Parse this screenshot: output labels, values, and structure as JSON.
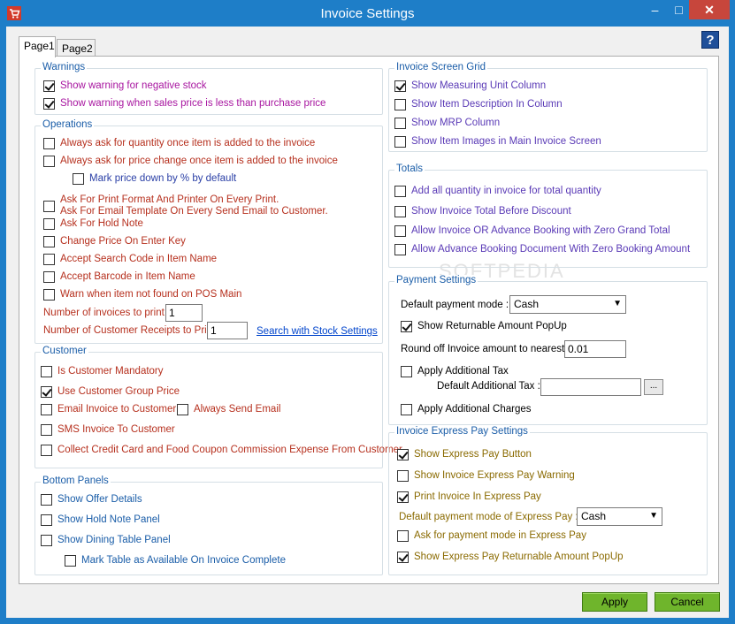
{
  "window": {
    "title": "Invoice Settings",
    "minimize": "–",
    "maximize": "□",
    "close": "✕"
  },
  "tabs": [
    {
      "label": "Page1"
    },
    {
      "label": "Page2"
    }
  ],
  "help": "?",
  "watermark": "SOFTPEDIA",
  "warnings": {
    "title": "Warnings",
    "items": [
      {
        "label": "Show warning for negative stock",
        "checked": true
      },
      {
        "label": "Show warning when sales price is less than purchase price",
        "checked": true
      }
    ]
  },
  "operations": {
    "title": "Operations",
    "items": [
      {
        "label": "Always ask for quantity once item is added to the invoice",
        "checked": false
      },
      {
        "label": "Always ask for price change once item is added to the invoice",
        "checked": false
      },
      {
        "label": "Mark price down by % by default",
        "checked": false
      },
      {
        "label": "Ask For Print Format And  Printer On Every Print.",
        "label2": "Ask For Email Template On Every Send Email to Customer.",
        "checked": false
      },
      {
        "label": "Ask For Hold Note",
        "checked": false
      },
      {
        "label": "Change Price On Enter Key",
        "checked": false
      },
      {
        "label": "Accept Search Code in Item Name",
        "checked": false
      },
      {
        "label": "Accept Barcode in Item Name",
        "checked": false
      },
      {
        "label": "Warn when item not found on POS Main",
        "checked": false
      }
    ],
    "invoices_to_print_label": "Number of invoices to print :",
    "invoices_to_print_value": "1",
    "receipts_to_print_label": "Number of Customer Receipts to Print :",
    "receipts_to_print_value": "1",
    "search_link": "Search with Stock Settings"
  },
  "customer": {
    "title": "Customer",
    "items": [
      {
        "label": "Is Customer Mandatory",
        "checked": false
      },
      {
        "label": "Use Customer Group Price",
        "checked": true
      },
      {
        "label": "Email Invoice to Customer",
        "checked": false
      },
      {
        "label": "Always Send Email",
        "checked": false
      },
      {
        "label": "SMS Invoice To Customer",
        "checked": false
      },
      {
        "label": "Collect Credit Card and Food Coupon Commission Expense From Customer",
        "checked": false
      }
    ]
  },
  "bottom_panels": {
    "title": "Bottom Panels",
    "items": [
      {
        "label": "Show Offer Details",
        "checked": false
      },
      {
        "label": "Show Hold Note Panel",
        "checked": false
      },
      {
        "label": "Show Dining Table Panel",
        "checked": false
      },
      {
        "label": "Mark Table as Available On Invoice Complete",
        "checked": false
      }
    ]
  },
  "invoice_grid": {
    "title": "Invoice Screen Grid",
    "items": [
      {
        "label": "Show Measuring Unit Column",
        "checked": true
      },
      {
        "label": "Show Item Description In Column",
        "checked": false
      },
      {
        "label": "Show MRP Column",
        "checked": false
      },
      {
        "label": "Show Item Images in Main Invoice Screen",
        "checked": false
      }
    ]
  },
  "totals": {
    "title": "Totals",
    "items": [
      {
        "label": "Add all quantity in invoice for total quantity",
        "checked": false
      },
      {
        "label": "Show Invoice Total Before Discount",
        "checked": false
      },
      {
        "label": "Allow Invoice OR Advance Booking with Zero Grand Total",
        "checked": false
      },
      {
        "label": "Allow Advance Booking Document With Zero Booking Amount",
        "checked": false
      }
    ]
  },
  "payment": {
    "title": "Payment Settings",
    "default_mode_label": "Default payment mode :",
    "default_mode_value": "Cash",
    "returnable_label": "Show Returnable Amount PopUp",
    "returnable_checked": true,
    "roundoff_label": "Round off Invoice amount to nearest :",
    "roundoff_value": "0.01",
    "additional_tax_label": "Apply Additional Tax",
    "additional_tax_checked": false,
    "default_tax_label": "Default Additional Tax :",
    "default_tax_value": "",
    "dots": "...",
    "additional_charges_label": "Apply Additional Charges",
    "additional_charges_checked": false
  },
  "express": {
    "title": "Invoice Express Pay Settings",
    "items": [
      {
        "label": "Show Express Pay Button",
        "checked": true
      },
      {
        "label": "Show Invoice Express Pay Warning",
        "checked": false
      },
      {
        "label": "Print Invoice In Express Pay",
        "checked": true
      }
    ],
    "default_mode_label": "Default payment mode of Express Pay :",
    "default_mode_value": "Cash",
    "items2": [
      {
        "label": "Ask for payment mode in Express Pay",
        "checked": false
      },
      {
        "label": "Show Express Pay Returnable Amount PopUp",
        "checked": true
      }
    ]
  },
  "buttons": {
    "apply": "Apply",
    "cancel": "Cancel"
  }
}
